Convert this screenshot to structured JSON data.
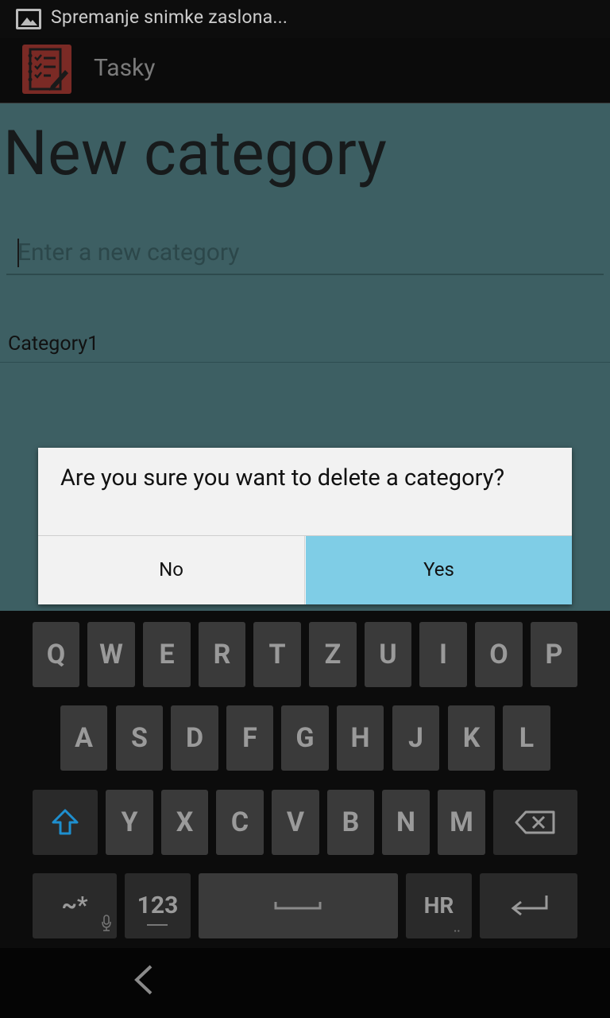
{
  "status_bar": {
    "notification_text": "Spremanje snimke zaslona..."
  },
  "action_bar": {
    "title": "Tasky"
  },
  "page": {
    "title": "New category",
    "input_placeholder": "Enter a new category",
    "categories": [
      "Category1"
    ]
  },
  "dialog": {
    "message": "Are you sure you want to delete a category?",
    "no_label": "No",
    "yes_label": "Yes"
  },
  "keyboard": {
    "row1": [
      "Q",
      "W",
      "E",
      "R",
      "T",
      "Z",
      "U",
      "I",
      "O",
      "P"
    ],
    "row2": [
      "A",
      "S",
      "D",
      "F",
      "G",
      "H",
      "J",
      "K",
      "L"
    ],
    "row3": [
      "Y",
      "X",
      "C",
      "V",
      "B",
      "N",
      "M"
    ],
    "symbols_label": "~*",
    "numbers_label": "123",
    "language_label": "HR"
  },
  "colors": {
    "dialog_yes_bg": "#7fcde6",
    "content_bg": "#3d5f63",
    "shift_icon": "#1e8fcf"
  }
}
